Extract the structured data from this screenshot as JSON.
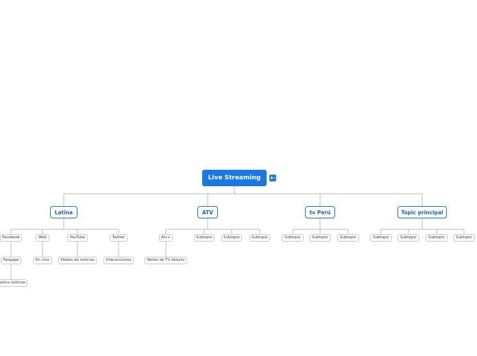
{
  "mindmap": {
    "central": {
      "label": "Live Streaming",
      "collapse_icon": "+-"
    },
    "topics": [
      {
        "label": "Latina",
        "children": [
          {
            "label": "Facebook",
            "children": [
              {
                "label": "Fangape",
                "children": [
                  {
                    "label": "Latina noticias"
                  }
                ]
              }
            ]
          },
          {
            "label": "Web",
            "children": [
              {
                "label": "En vivo"
              }
            ]
          },
          {
            "label": "YouTube",
            "children": [
              {
                "label": "Videos de noticias"
              }
            ]
          },
          {
            "label": "Twitter",
            "children": [
              {
                "label": "Interacciones"
              }
            ]
          }
        ]
      },
      {
        "label": "ATV",
        "children": [
          {
            "label": "Atv+",
            "children": [
              {
                "label": "Notas de TV directo"
              }
            ]
          },
          {
            "label": "Subtopic"
          },
          {
            "label": "Subtopic"
          },
          {
            "label": "Subtopic"
          }
        ]
      },
      {
        "label": "tv Perú",
        "children": [
          {
            "label": "Subtopic"
          },
          {
            "label": "Subtopic"
          },
          {
            "label": "Subtopic"
          }
        ]
      },
      {
        "label": "Topic principal",
        "children": [
          {
            "label": "Subtopic"
          },
          {
            "label": "Subtopic"
          },
          {
            "label": "Subtopic"
          },
          {
            "label": "Subtopic"
          }
        ]
      }
    ]
  },
  "colors": {
    "central": "#1b78e0",
    "topic_border": "#1e6fd6",
    "link": "#b8b8b8"
  }
}
